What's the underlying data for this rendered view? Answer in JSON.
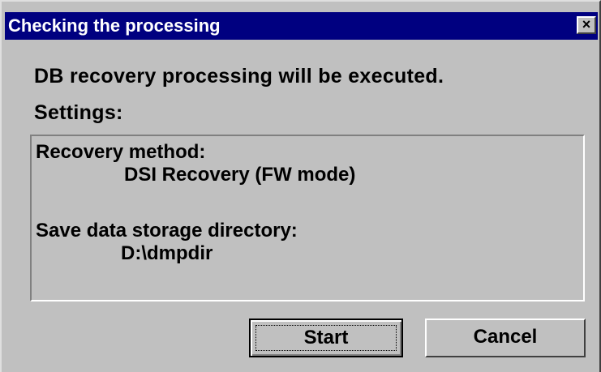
{
  "dialog": {
    "title": "Checking the processing",
    "close_glyph": "×"
  },
  "message": {
    "line1": "DB recovery processing will be executed.",
    "line2": "Settings:"
  },
  "settings": {
    "recovery_method_label": "Recovery method:",
    "recovery_method_value": "DSI Recovery (FW mode)",
    "save_dir_label": "Save data storage directory:",
    "save_dir_value": "D:\\dmpdir"
  },
  "buttons": {
    "start": "Start",
    "cancel": "Cancel"
  },
  "colors": {
    "titlebar": "#000080",
    "face": "#c0c0c0"
  }
}
